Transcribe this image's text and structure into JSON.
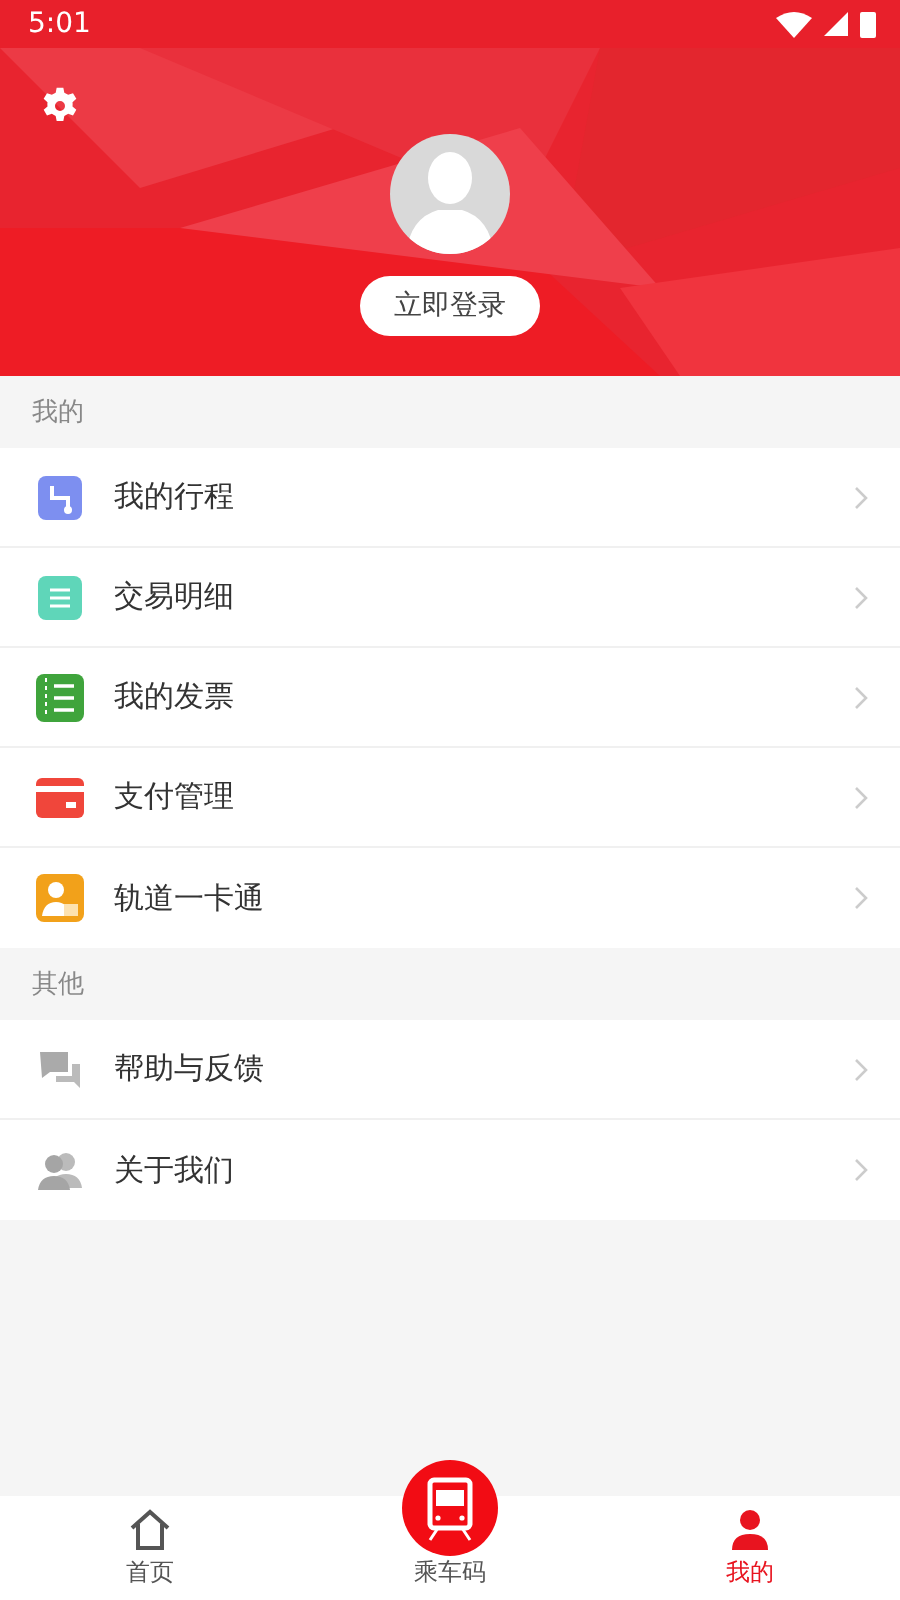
{
  "status_bar": {
    "time": "5:01"
  },
  "header": {
    "login_button": "立即登录"
  },
  "sections": [
    {
      "title": "我的",
      "items": [
        {
          "label": "我的行程",
          "kind": "route"
        },
        {
          "label": "交易明细",
          "kind": "list"
        },
        {
          "label": "我的发票",
          "kind": "invoice"
        },
        {
          "label": "支付管理",
          "kind": "card"
        },
        {
          "label": "轨道一卡通",
          "kind": "member"
        }
      ]
    },
    {
      "title": "其他",
      "items": [
        {
          "label": "帮助与反馈",
          "kind": "help"
        },
        {
          "label": "关于我们",
          "kind": "about"
        }
      ]
    }
  ],
  "tab_bar": [
    {
      "label": "首页",
      "kind": "home",
      "selected": false
    },
    {
      "label": "乘车码",
      "kind": "train",
      "selected": false
    },
    {
      "label": "我的",
      "kind": "profile",
      "selected": true
    }
  ]
}
